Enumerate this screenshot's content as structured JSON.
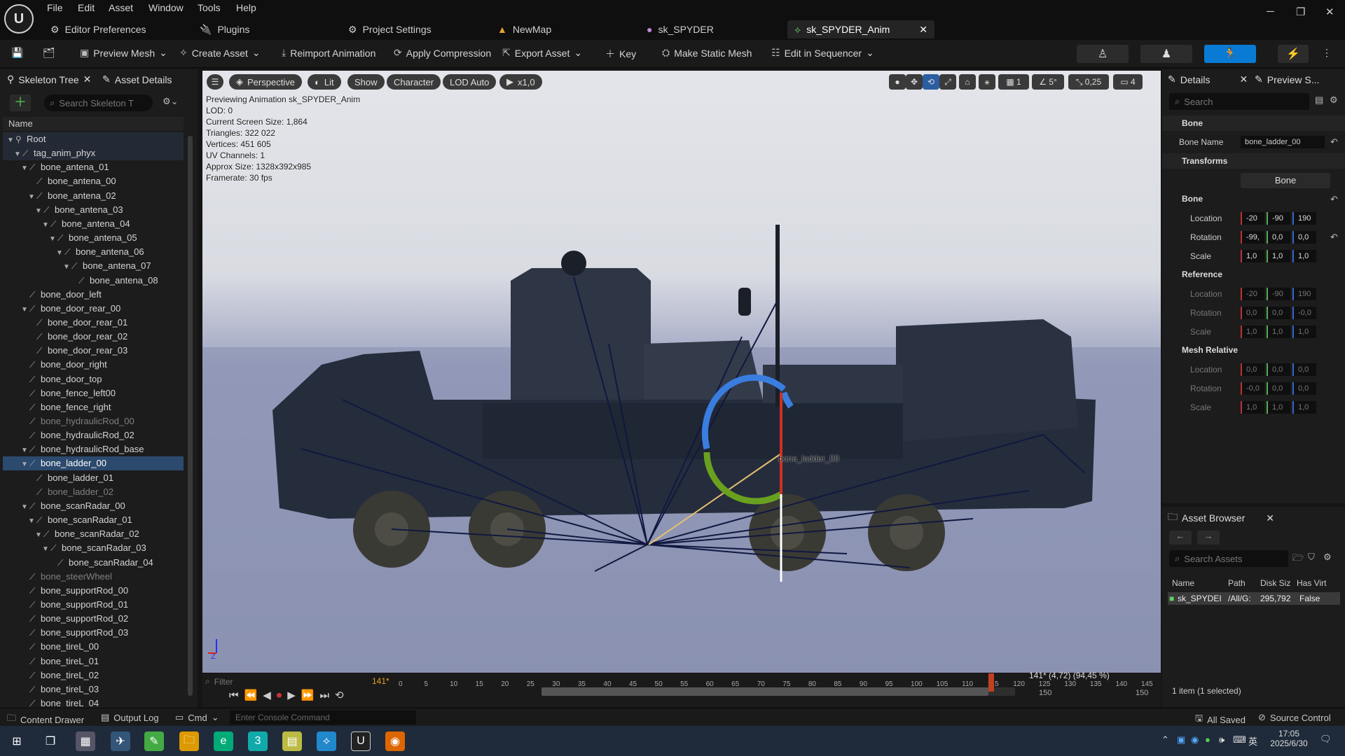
{
  "menu": {
    "items": [
      "File",
      "Edit",
      "Asset",
      "Window",
      "Tools",
      "Help"
    ]
  },
  "tabs": [
    {
      "label": "Editor Preferences"
    },
    {
      "label": "Plugins"
    },
    {
      "label": "Project Settings"
    },
    {
      "label": "NewMap"
    },
    {
      "label": "sk_SPYDER"
    },
    {
      "label": "sk_SPYDER_Anim"
    }
  ],
  "toolbar": {
    "preview_mesh": "Preview Mesh",
    "create_asset": "Create Asset",
    "reimport": "Reimport Animation",
    "apply_compression": "Apply Compression",
    "export_asset": "Export Asset",
    "key": "Key",
    "make_static": "Make Static Mesh",
    "edit_sequencer": "Edit in Sequencer"
  },
  "skeleton": {
    "tab1": "Skeleton Tree",
    "tab2": "Asset Details",
    "search_placeholder": "Search Skeleton T",
    "column_name": "Name",
    "bones": [
      {
        "name": "Root"
      },
      {
        "name": "tag_anim_phyx"
      },
      {
        "name": "bone_antena_01"
      },
      {
        "name": "bone_antena_00"
      },
      {
        "name": "bone_antena_02"
      },
      {
        "name": "bone_antena_03"
      },
      {
        "name": "bone_antena_04"
      },
      {
        "name": "bone_antena_05"
      },
      {
        "name": "bone_antena_06"
      },
      {
        "name": "bone_antena_07"
      },
      {
        "name": "bone_antena_08"
      },
      {
        "name": "bone_door_left"
      },
      {
        "name": "bone_door_rear_00"
      },
      {
        "name": "bone_door_rear_01"
      },
      {
        "name": "bone_door_rear_02"
      },
      {
        "name": "bone_door_rear_03"
      },
      {
        "name": "bone_door_right"
      },
      {
        "name": "bone_door_top"
      },
      {
        "name": "bone_fence_left00"
      },
      {
        "name": "bone_fence_right"
      },
      {
        "name": "bone_hydraulicRod_00"
      },
      {
        "name": "bone_hydraulicRod_02"
      },
      {
        "name": "bone_hydraulicRod_base"
      },
      {
        "name": "bone_ladder_00"
      },
      {
        "name": "bone_ladder_01"
      },
      {
        "name": "bone_ladder_02"
      },
      {
        "name": "bone_scanRadar_00"
      },
      {
        "name": "bone_scanRadar_01"
      },
      {
        "name": "bone_scanRadar_02"
      },
      {
        "name": "bone_scanRadar_03"
      },
      {
        "name": "bone_scanRadar_04"
      },
      {
        "name": "bone_steerWheel"
      },
      {
        "name": "bone_supportRod_00"
      },
      {
        "name": "bone_supportRod_01"
      },
      {
        "name": "bone_supportRod_02"
      },
      {
        "name": "bone_supportRod_03"
      },
      {
        "name": "bone_tireL_00"
      },
      {
        "name": "bone_tireL_01"
      },
      {
        "name": "bone_tireL_02"
      },
      {
        "name": "bone_tireL_03"
      },
      {
        "name": "bone_tireL_04"
      }
    ]
  },
  "viewport": {
    "perspective": "Perspective",
    "lit": "Lit",
    "show": "Show",
    "character": "Character",
    "lod": "LOD Auto",
    "speed": "x1,0",
    "grid_value": "1",
    "angle_value": "5°",
    "scale_value": "0,25",
    "camera_value": "4",
    "stats": [
      "Previewing Animation sk_SPYDER_Anim",
      "LOD: 0",
      "Current Screen Size: 1,864",
      "Triangles: 322 022",
      "Vertices: 451 605",
      "UV Channels: 1",
      "Approx Size: 1328x392x985",
      "Framerate: 30 fps"
    ],
    "bone_label": "bone_ladder_00"
  },
  "timeline": {
    "filter_placeholder": "Filter",
    "current_frame": "141*",
    "frame_readout": "141* (4,72) (94,45 %)",
    "ticks": [
      "0",
      "5",
      "10",
      "15",
      "20",
      "25",
      "30",
      "35",
      "40",
      "45",
      "50",
      "55",
      "60",
      "65",
      "70",
      "75",
      "80",
      "85",
      "90",
      "95",
      "100",
      "105",
      "110",
      "115",
      "120",
      "125",
      "130",
      "135",
      "140",
      "145"
    ],
    "end_left": "150",
    "end_right": "150",
    "progress": 0.9445
  },
  "details": {
    "tab1": "Details",
    "tab2": "Preview S...",
    "search_placeholder": "Search",
    "sec_bone": "Bone",
    "bone_name_label": "Bone Name",
    "bone_name_value": "bone_ladder_00",
    "sec_transforms": "Transforms",
    "transform_mode": "Bone",
    "sec_bone2": "Bone",
    "location_label": "Location",
    "location": [
      "-20",
      "-90",
      "190"
    ],
    "rotation_label": "Rotation",
    "rotation": [
      "-99,",
      "0,0",
      "0,0"
    ],
    "scale_label": "Scale",
    "scale": [
      "1,0",
      "1,0",
      "1,0"
    ],
    "sec_reference": "Reference",
    "ref_location": [
      "-20",
      "-90",
      "190"
    ],
    "ref_rotation": [
      "0,0",
      "0,0",
      "-0,0"
    ],
    "ref_scale": [
      "1,0",
      "1,0",
      "1,0"
    ],
    "sec_mesh_relative": "Mesh Relative",
    "mr_location": [
      "0,0",
      "0,0",
      "0,0"
    ],
    "mr_rotation": [
      "-0,0",
      "0,0",
      "0,0"
    ],
    "mr_scale": [
      "1,0",
      "1,0",
      "1,0"
    ]
  },
  "asset_browser": {
    "title": "Asset Browser",
    "search_placeholder": "Search Assets",
    "col_name": "Name",
    "col_path": "Path",
    "col_disk": "Disk Siz",
    "col_virt": "Has Virt",
    "row": {
      "name": "sk_SPYDEI",
      "path": "/All/G:",
      "disk": "295,792",
      "virt": "False"
    },
    "footer": "1 item (1 selected)"
  },
  "statusbar": {
    "content_drawer": "Content Drawer",
    "output_log": "Output Log",
    "cmd": "Cmd",
    "console_placeholder": "Enter Console Command",
    "all_saved": "All Saved",
    "source_control": "Source Control"
  },
  "taskbar": {
    "time": "17:05",
    "date": "2025/6/30",
    "ime": "英"
  }
}
